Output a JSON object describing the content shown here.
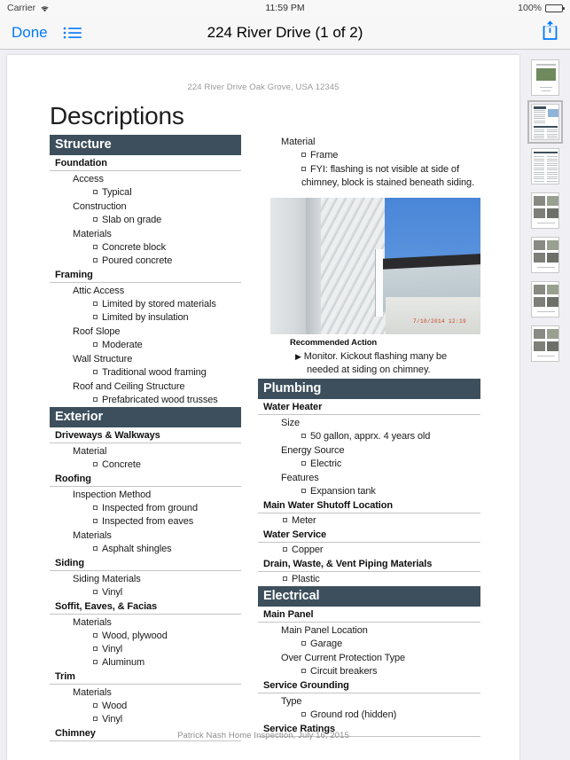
{
  "status_bar": {
    "carrier": "Carrier",
    "wifi_icon": "wifi-icon",
    "time": "11:59 PM",
    "battery_percent": "100%",
    "battery_icon": "battery-full-icon"
  },
  "nav_bar": {
    "done_label": "Done",
    "list_icon": "bulleted-list-icon",
    "title": "224 River Drive (1 of 2)",
    "share_icon": "share-icon"
  },
  "document": {
    "address_line": "224 River Drive Oak Grove, USA 12345",
    "title": "Descriptions",
    "footer": "Patrick Nash Home Inspection, July 16, 2015",
    "left_column": [
      {
        "kind": "section",
        "text": "Structure"
      },
      {
        "kind": "sub",
        "text": "Foundation"
      },
      {
        "kind": "field",
        "text": "Access"
      },
      {
        "kind": "value",
        "text": "Typical"
      },
      {
        "kind": "field",
        "text": "Construction"
      },
      {
        "kind": "value",
        "text": "Slab on grade"
      },
      {
        "kind": "field",
        "text": "Materials"
      },
      {
        "kind": "value",
        "text": "Concrete block"
      },
      {
        "kind": "value",
        "text": "Poured concrete"
      },
      {
        "kind": "sub",
        "text": "Framing"
      },
      {
        "kind": "field",
        "text": "Attic Access"
      },
      {
        "kind": "value",
        "text": "Limited by stored materials"
      },
      {
        "kind": "value",
        "text": "Limited by insulation"
      },
      {
        "kind": "field",
        "text": "Roof Slope"
      },
      {
        "kind": "value",
        "text": "Moderate"
      },
      {
        "kind": "field",
        "text": "Wall Structure"
      },
      {
        "kind": "value",
        "text": "Traditional wood framing"
      },
      {
        "kind": "field",
        "text": "Roof and Ceiling Structure"
      },
      {
        "kind": "value",
        "text": "Prefabricated wood trusses"
      },
      {
        "kind": "section",
        "text": "Exterior"
      },
      {
        "kind": "sub",
        "text": "Driveways & Walkways"
      },
      {
        "kind": "field",
        "text": "Material"
      },
      {
        "kind": "value",
        "text": "Concrete"
      },
      {
        "kind": "sub",
        "text": "Roofing"
      },
      {
        "kind": "field",
        "text": "Inspection Method"
      },
      {
        "kind": "value",
        "text": "Inspected from ground"
      },
      {
        "kind": "value",
        "text": "Inspected from eaves"
      },
      {
        "kind": "field",
        "text": "Materials"
      },
      {
        "kind": "value",
        "text": "Asphalt shingles"
      },
      {
        "kind": "sub",
        "text": "Siding"
      },
      {
        "kind": "field",
        "text": "Siding Materials"
      },
      {
        "kind": "value",
        "text": "Vinyl"
      },
      {
        "kind": "sub",
        "text": "Soffit, Eaves, & Facias"
      },
      {
        "kind": "field",
        "text": "Materials"
      },
      {
        "kind": "value",
        "text": "Wood, plywood"
      },
      {
        "kind": "value",
        "text": "Vinyl"
      },
      {
        "kind": "value",
        "text": "Aluminum"
      },
      {
        "kind": "sub",
        "text": "Trim"
      },
      {
        "kind": "field",
        "text": "Materials"
      },
      {
        "kind": "value",
        "text": "Wood"
      },
      {
        "kind": "value",
        "text": "Vinyl"
      },
      {
        "kind": "sub",
        "text": "Chimney"
      }
    ],
    "right_column_top": [
      {
        "kind": "field",
        "text": "Material"
      },
      {
        "kind": "value",
        "text": "Frame"
      },
      {
        "kind": "value-wrap",
        "text": "FYI: flashing is not visible at side of chimney, block is stained beneath siding."
      }
    ],
    "photo": {
      "name": "chimney-flashing-photo",
      "timestamp": "7/10/2014  12:19"
    },
    "recommended_action": {
      "label": "Recommended Action",
      "text": "Monitor.  Kickout flashing many be needed at siding on chimney."
    },
    "right_column_bottom": [
      {
        "kind": "section",
        "text": "Plumbing"
      },
      {
        "kind": "sub",
        "text": "Water Heater"
      },
      {
        "kind": "field",
        "text": "Size"
      },
      {
        "kind": "value",
        "text": "50 gallon, apprx. 4 years old"
      },
      {
        "kind": "field",
        "text": "Energy Source"
      },
      {
        "kind": "value",
        "text": "Electric"
      },
      {
        "kind": "field",
        "text": "Features"
      },
      {
        "kind": "value",
        "text": "Expansion tank"
      },
      {
        "kind": "sub",
        "text": "Main Water Shutoff Location"
      },
      {
        "kind": "value-shallow",
        "text": "Meter"
      },
      {
        "kind": "sub",
        "text": "Water Service"
      },
      {
        "kind": "value-shallow",
        "text": "Copper"
      },
      {
        "kind": "sub",
        "text": "Drain, Waste, & Vent Piping Materials"
      },
      {
        "kind": "value-shallow",
        "text": "Plastic"
      },
      {
        "kind": "section",
        "text": "Electrical"
      },
      {
        "kind": "sub",
        "text": "Main Panel"
      },
      {
        "kind": "field",
        "text": "Main Panel Location"
      },
      {
        "kind": "value",
        "text": "Garage"
      },
      {
        "kind": "field",
        "text": "Over Current Protection Type"
      },
      {
        "kind": "value",
        "text": "Circuit breakers"
      },
      {
        "kind": "sub",
        "text": "Service Grounding"
      },
      {
        "kind": "field",
        "text": "Type"
      },
      {
        "kind": "value",
        "text": "Ground rod (hidden)"
      },
      {
        "kind": "sub",
        "text": "Service Ratings"
      }
    ]
  },
  "thumbnail_rail": {
    "selected_index": 1,
    "thumbs": [
      {
        "name": "thumbnail-page-1",
        "layout": "cover"
      },
      {
        "name": "thumbnail-page-2",
        "layout": "report"
      },
      {
        "name": "thumbnail-page-3",
        "layout": "text"
      },
      {
        "name": "thumbnail-page-4",
        "layout": "photos"
      },
      {
        "name": "thumbnail-page-5",
        "layout": "photos"
      },
      {
        "name": "thumbnail-page-6",
        "layout": "photos"
      },
      {
        "name": "thumbnail-page-7",
        "layout": "photos"
      }
    ]
  },
  "colors": {
    "section_header_bg": "#3d4f5c",
    "accent_blue": "#007aff",
    "page_bg": "#efeff4"
  }
}
